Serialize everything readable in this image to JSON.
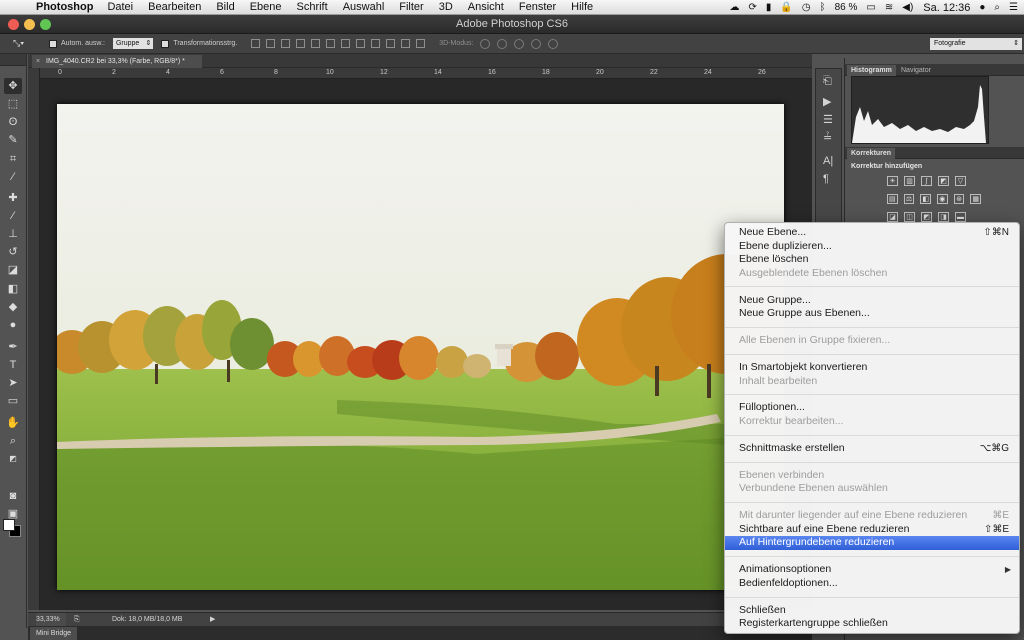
{
  "menubar": {
    "app": "Photoshop",
    "items": [
      "Datei",
      "Bearbeiten",
      "Bild",
      "Ebene",
      "Schrift",
      "Auswahl",
      "Filter",
      "3D",
      "Ansicht",
      "Fenster",
      "Hilfe"
    ],
    "battery": "86 %",
    "clock": "Sa. 12:36"
  },
  "window": {
    "title": "Adobe Photoshop CS6"
  },
  "options": {
    "auto_select_label": "Autom. ausw.:",
    "auto_select_value": "Gruppe",
    "transform_label": "Transformationsstrg.",
    "mode_3d_label": "3D-Modus:",
    "workspace": "Fotografie"
  },
  "document": {
    "tab_title": "IMG_4040.CR2 bei 33,3% (Farbe, RGB/8*) *",
    "close_glyph": "×",
    "ruler_marks": [
      "0",
      "2",
      "4",
      "6",
      "8",
      "10",
      "12",
      "14",
      "16",
      "18",
      "20",
      "22",
      "24",
      "26"
    ]
  },
  "statusbar": {
    "zoom": "33,33%",
    "doc_info": "Dok: 18,0 MB/18,0 MB"
  },
  "bottom_panel": {
    "tab": "Mini Bridge"
  },
  "panels": {
    "top_tabs": [
      "Histogramm",
      "Navigator"
    ],
    "mid_tab": "Korrekturen",
    "adjust_subtitle": "Korrektur hinzufügen"
  },
  "context_menu": {
    "groups": [
      [
        {
          "label": "Neue Ebene...",
          "shortcut": "⇧⌘N",
          "enabled": true
        },
        {
          "label": "Ebene duplizieren...",
          "enabled": true
        },
        {
          "label": "Ebene löschen",
          "enabled": true
        },
        {
          "label": "Ausgeblendete Ebenen löschen",
          "enabled": false
        }
      ],
      [
        {
          "label": "Neue Gruppe...",
          "enabled": true
        },
        {
          "label": "Neue Gruppe aus Ebenen...",
          "enabled": true
        }
      ],
      [
        {
          "label": "Alle Ebenen in Gruppe fixieren...",
          "enabled": false
        }
      ],
      [
        {
          "label": "In Smartobjekt konvertieren",
          "enabled": true
        },
        {
          "label": "Inhalt bearbeiten",
          "enabled": false
        }
      ],
      [
        {
          "label": "Fülloptionen...",
          "enabled": true
        },
        {
          "label": "Korrektur bearbeiten...",
          "enabled": false
        }
      ],
      [
        {
          "label": "Schnittmaske erstellen",
          "shortcut": "⌥⌘G",
          "enabled": true
        }
      ],
      [
        {
          "label": "Ebenen verbinden",
          "enabled": false
        },
        {
          "label": "Verbundene Ebenen auswählen",
          "enabled": false
        }
      ],
      [
        {
          "label": "Mit darunter liegender auf eine Ebene reduzieren",
          "shortcut": "⌘E",
          "enabled": false
        },
        {
          "label": "Sichtbare auf eine Ebene reduzieren",
          "shortcut": "⇧⌘E",
          "enabled": true
        },
        {
          "label": "Auf Hintergrundebene reduzieren",
          "enabled": true,
          "highlighted": true
        }
      ],
      [
        {
          "label": "Animationsoptionen",
          "enabled": true,
          "submenu": true
        },
        {
          "label": "Bedienfeldoptionen...",
          "enabled": true
        }
      ],
      [
        {
          "label": "Schließen",
          "enabled": true
        },
        {
          "label": "Registerkartengruppe schließen",
          "enabled": true
        }
      ]
    ]
  },
  "colors": {
    "app_bg": "#535353",
    "menu_highlight": "#3a6fe3",
    "sky": "#eef0ec",
    "grass": "#7fa83a"
  }
}
